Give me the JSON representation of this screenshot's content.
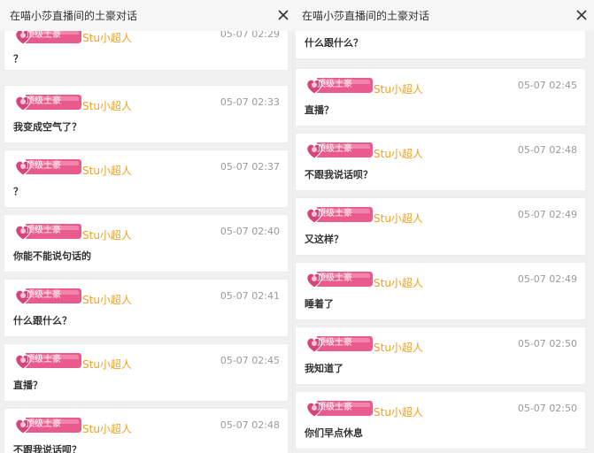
{
  "left": {
    "title": "在喵小莎直播间的土豪对话",
    "messages": [
      {
        "badge": "顶级土豪",
        "user": "Stu小超人",
        "time": "05-07 02:29",
        "text": "？"
      },
      {
        "badge": "顶级土豪",
        "user": "Stu小超人",
        "time": "05-07 02:33",
        "text": "我变成空气了？"
      },
      {
        "badge": "顶级土豪",
        "user": "Stu小超人",
        "time": "05-07 02:37",
        "text": "？"
      },
      {
        "badge": "顶级土豪",
        "user": "Stu小超人",
        "time": "05-07 02:40",
        "text": "你能不能说句话的"
      },
      {
        "badge": "顶级土豪",
        "user": "Stu小超人",
        "time": "05-07 02:41",
        "text": "什么跟什么？"
      },
      {
        "badge": "顶级土豪",
        "user": "Stu小超人",
        "time": "05-07 02:45",
        "text": "直播？"
      },
      {
        "badge": "顶级土豪",
        "user": "Stu小超人",
        "time": "05-07 02:48",
        "text": "不跟我说话呗？"
      }
    ]
  },
  "right": {
    "title": "在喵小莎直播间的土豪对话",
    "messages": [
      {
        "badge": "",
        "user": "",
        "time": "",
        "text": "什么跟什么？"
      },
      {
        "badge": "顶级土豪",
        "user": "Stu小超人",
        "time": "05-07 02:45",
        "text": "直播？"
      },
      {
        "badge": "顶级土豪",
        "user": "Stu小超人",
        "time": "05-07 02:48",
        "text": "不跟我说话呗？"
      },
      {
        "badge": "顶级土豪",
        "user": "Stu小超人",
        "time": "05-07 02:49",
        "text": "又这样？"
      },
      {
        "badge": "顶级土豪",
        "user": "Stu小超人",
        "time": "05-07 02:49",
        "text": "睡着了"
      },
      {
        "badge": "顶级土豪",
        "user": "Stu小超人",
        "time": "05-07 02:50",
        "text": "我知道了"
      },
      {
        "badge": "顶级土豪",
        "user": "Stu小超人",
        "time": "05-07 02:50",
        "text": "你们早点休息"
      }
    ]
  },
  "icons": {
    "close": "close-icon",
    "badge": "heart-badge-icon"
  },
  "colors": {
    "badge_pink": "#e95b8c",
    "badge_light": "#f7a8c4",
    "username": "#f0a01e",
    "time": "#9a9a9a"
  }
}
